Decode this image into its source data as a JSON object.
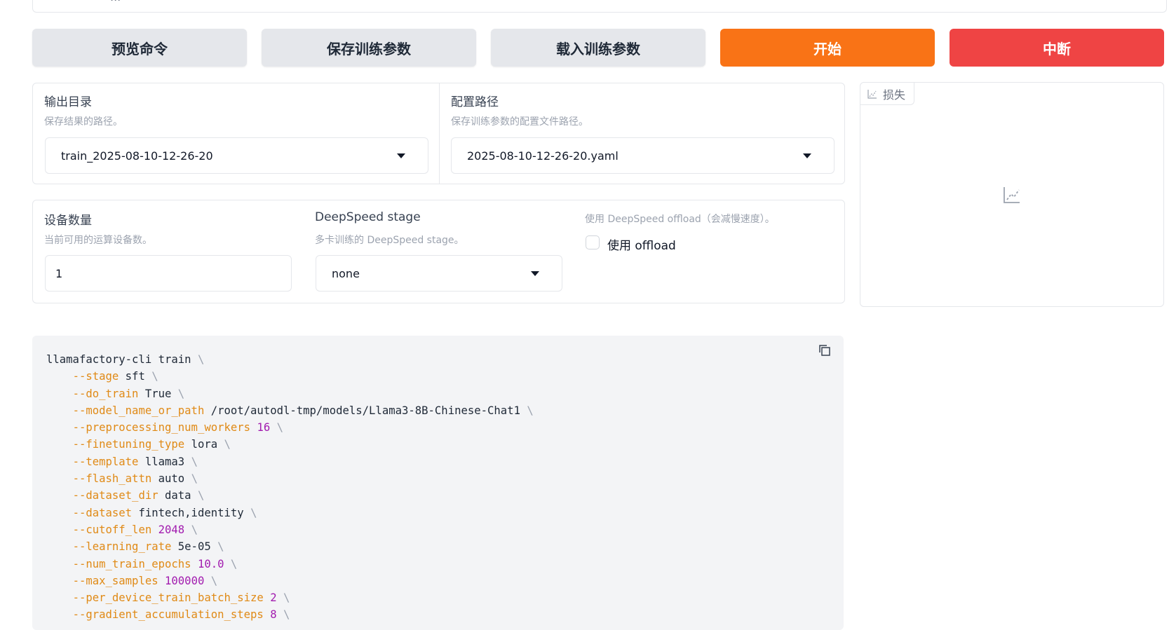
{
  "top_field": {
    "value": "..."
  },
  "buttons": {
    "preview": "预览命令",
    "save": "保存训练参数",
    "load": "载入训练参数",
    "start": "开始",
    "abort": "中断"
  },
  "output_dir": {
    "label": "输出目录",
    "info": "保存结果的路径。",
    "value": "train_2025-08-10-12-26-20"
  },
  "config_path": {
    "label": "配置路径",
    "info": "保存训练参数的配置文件路径。",
    "value": "2025-08-10-12-26-20.yaml"
  },
  "device_count": {
    "label": "设备数量",
    "info": "当前可用的运算设备数。",
    "value": "1"
  },
  "ds_stage": {
    "label": "DeepSpeed stage",
    "info": "多卡训练的 DeepSpeed stage。",
    "value": "none"
  },
  "ds_offload": {
    "info": "使用 DeepSpeed offload（会减慢速度）。",
    "label": "使用 offload",
    "checked": false
  },
  "loss_plot": {
    "tab_label": "损失"
  },
  "command": {
    "first_line": "llamafactory-cli train",
    "args": [
      {
        "flag": "--stage",
        "value": "sft",
        "numeric": false
      },
      {
        "flag": "--do_train",
        "value": "True",
        "numeric": false
      },
      {
        "flag": "--model_name_or_path",
        "value": "/root/autodl-tmp/models/Llama3-8B-Chinese-Chat1",
        "numeric": false
      },
      {
        "flag": "--preprocessing_num_workers",
        "value": "16",
        "numeric": true
      },
      {
        "flag": "--finetuning_type",
        "value": "lora",
        "numeric": false
      },
      {
        "flag": "--template",
        "value": "llama3",
        "numeric": false
      },
      {
        "flag": "--flash_attn",
        "value": "auto",
        "numeric": false
      },
      {
        "flag": "--dataset_dir",
        "value": "data",
        "numeric": false
      },
      {
        "flag": "--dataset",
        "value": "fintech,identity",
        "numeric": false
      },
      {
        "flag": "--cutoff_len",
        "value": "2048",
        "numeric": true
      },
      {
        "flag": "--learning_rate",
        "value": "5e-05",
        "numeric": false
      },
      {
        "flag": "--num_train_epochs",
        "value": "10.0",
        "numeric": true
      },
      {
        "flag": "--max_samples",
        "value": "100000",
        "numeric": true
      },
      {
        "flag": "--per_device_train_batch_size",
        "value": "2",
        "numeric": true
      },
      {
        "flag": "--gradient_accumulation_steps",
        "value": "8",
        "numeric": true
      }
    ]
  },
  "colors": {
    "primary": "#f97316",
    "stop": "#ef4444",
    "secondary": "#e5e7eb",
    "flag": "#e08a16",
    "number": "#a21caf"
  }
}
